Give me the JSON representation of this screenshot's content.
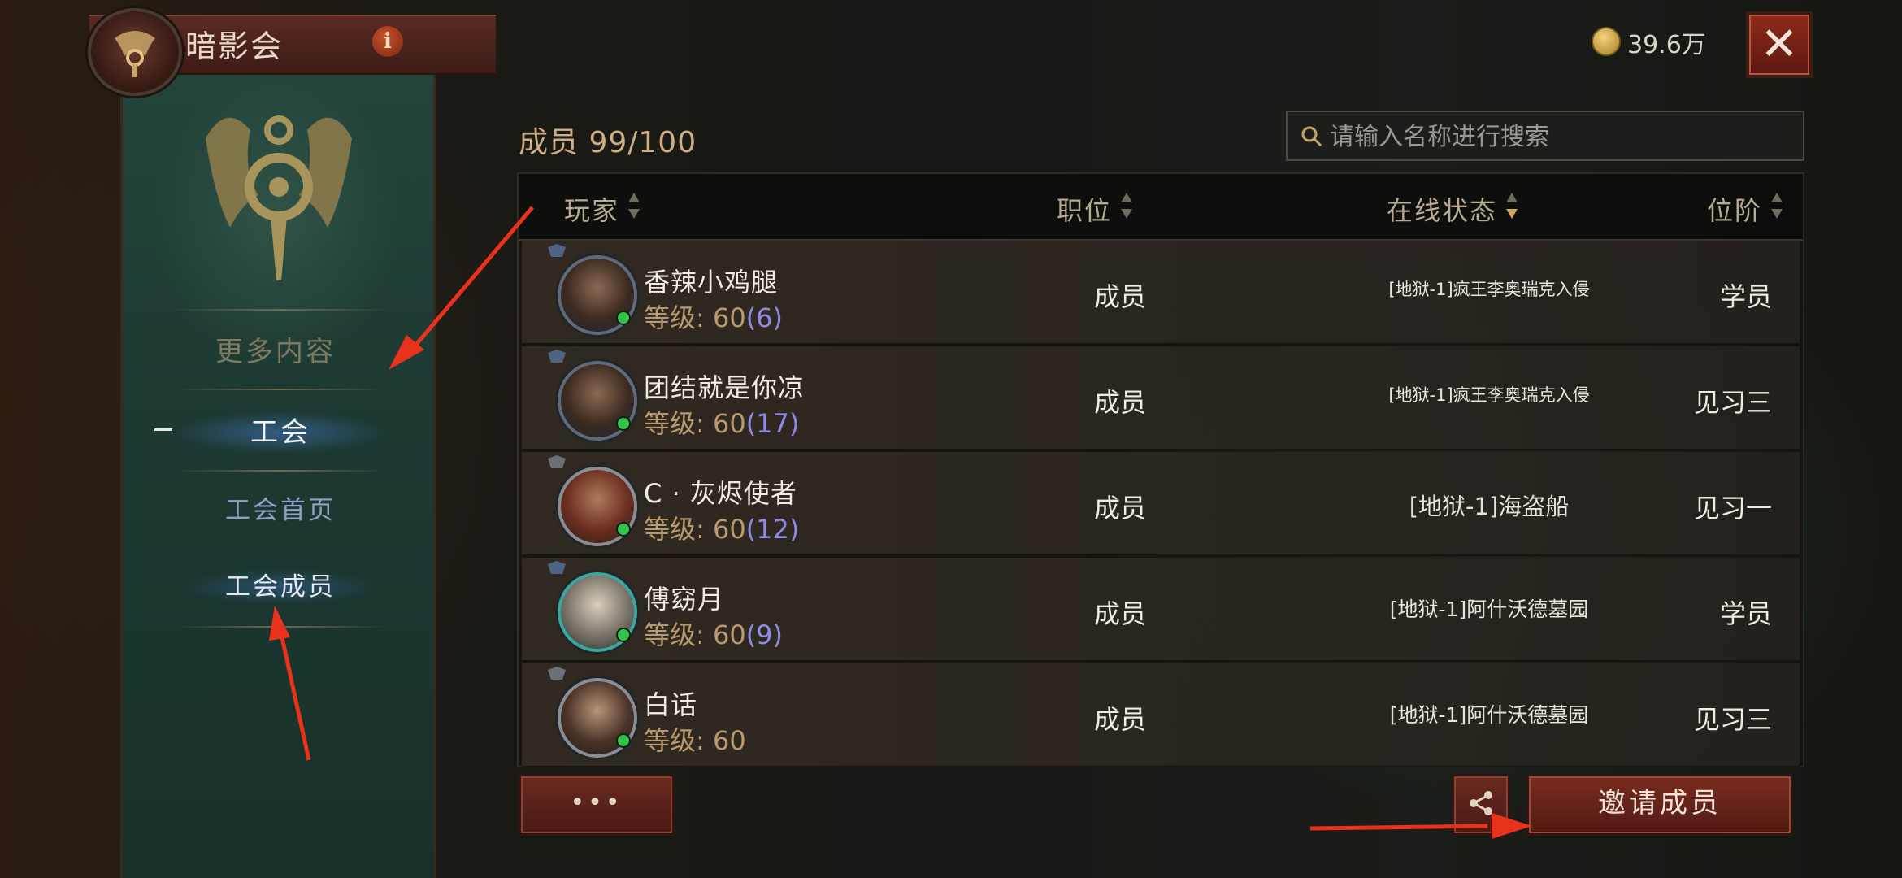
{
  "header": {
    "title": "暗影会",
    "info_symbol": "i",
    "currency_value": "39.6万",
    "close_symbol": "✕"
  },
  "sidebar": {
    "more_content": "更多内容",
    "items": [
      {
        "label": "工会"
      },
      {
        "label": "工会首页"
      },
      {
        "label": "工会成员"
      }
    ]
  },
  "main": {
    "member_count": "成员 99/100",
    "search_placeholder": "请输入名称进行搜索",
    "columns": [
      "玩家",
      "职位",
      "在线状态",
      "位阶"
    ],
    "rows": [
      {
        "name": "香辣小鸡腿",
        "level_label": "等级: 60",
        "level_suffix": "(6)",
        "role": "成员",
        "status": "[地狱-1]疯王李奥瑞克入侵",
        "rank": "学员"
      },
      {
        "name": "团结就是你凉",
        "level_label": "等级: 60",
        "level_suffix": "(17)",
        "role": "成员",
        "status": "[地狱-1]疯王李奥瑞克入侵",
        "rank": "见习三"
      },
      {
        "name": "C · 灰烬使者",
        "level_label": "等级: 60",
        "level_suffix": "(12)",
        "role": "成员",
        "status": "[地狱-1]海盗船",
        "rank": "见习一"
      },
      {
        "name": "傅窈月",
        "level_label": "等级: 60",
        "level_suffix": "(9)",
        "role": "成员",
        "status": "[地狱-1]阿什沃德墓园",
        "rank": "学员"
      },
      {
        "name": "白话",
        "level_label": "等级: 60",
        "level_suffix": "",
        "role": "成员",
        "status": "[地狱-1]阿什沃德墓园",
        "rank": "见习三"
      }
    ]
  },
  "footer": {
    "more_label": "•••",
    "invite_label": "邀请成员"
  },
  "colors": {
    "accent_red": "#7a2c20",
    "online_green": "#33c24a",
    "level_tan": "#b99a6e",
    "level_suffix_purple": "#8f8ae6",
    "annotation_arrow": "#e8321c"
  }
}
